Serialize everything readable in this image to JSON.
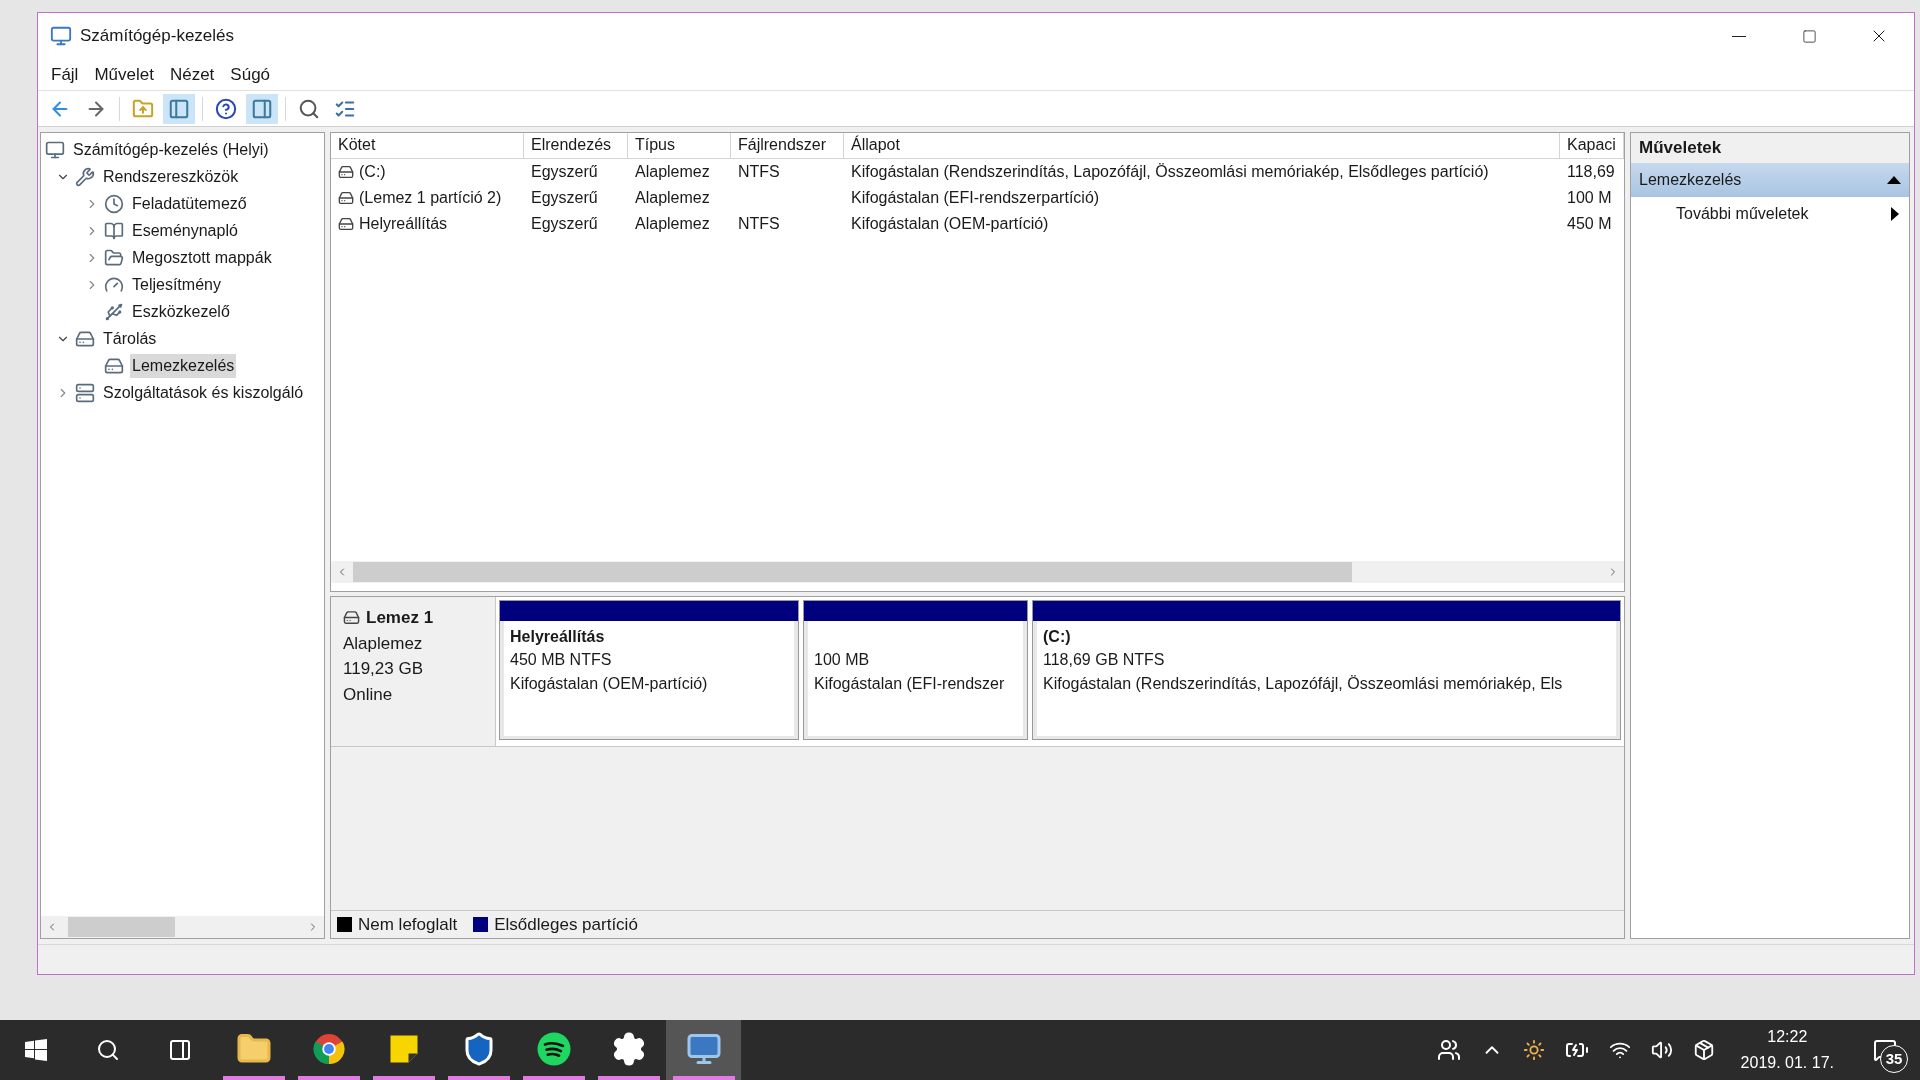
{
  "window": {
    "title": "Számítógép-kezelés"
  },
  "menu": [
    "Fájl",
    "Művelet",
    "Nézet",
    "Súgó"
  ],
  "toolbar": [
    {
      "selected": false
    },
    {
      "selected": false
    },
    {
      "selected": false
    },
    {
      "selected": true
    },
    {
      "selected": false
    },
    {
      "selected": true
    },
    {
      "selected": false
    },
    {
      "selected": false
    }
  ],
  "tree": [
    {
      "label": "Számítógép-kezelés (Helyi)",
      "selected": false,
      "children": [
        {
          "label": "Rendszereszközök",
          "expanded": true,
          "selected": false,
          "children": [
            {
              "label": "Feladatütemező",
              "expanded": false,
              "selected": false
            },
            {
              "label": "Eseménynapló",
              "expanded": false,
              "selected": false
            },
            {
              "label": "Megosztott mappák",
              "expanded": false,
              "selected": false
            },
            {
              "label": "Teljesítmény",
              "expanded": false,
              "selected": false
            },
            {
              "label": "Eszközkezelő",
              "selected": false
            }
          ]
        },
        {
          "label": "Tárolás",
          "expanded": true,
          "selected": false,
          "children": [
            {
              "label": "Lemezkezelés",
              "selected": true
            }
          ]
        },
        {
          "label": "Szolgáltatások és kiszolgáló",
          "expanded": false,
          "selected": false
        }
      ]
    }
  ],
  "table": {
    "columns": [
      "Kötet",
      "Elrendezés",
      "Típus",
      "Fájlrendszer",
      "Állapot",
      "Kapaci"
    ],
    "rows": [
      [
        "(C:)",
        "Egyszerű",
        "Alaplemez",
        "NTFS",
        "Kifogástalan (Rendszerindítás, Lapozófájl, Összeomlási memóriakép, Elsődleges partíció)",
        "118,69"
      ],
      [
        "(Lemez 1 partíció 2)",
        "Egyszerű",
        "Alaplemez",
        "",
        "Kifogástalan (EFI-rendszerpartíció)",
        "100 M"
      ],
      [
        "Helyreállítás",
        "Egyszerű",
        "Alaplemez",
        "NTFS",
        "Kifogástalan (OEM-partíció)",
        "450 M"
      ]
    ]
  },
  "disk": {
    "name": "Lemez 1",
    "type": "Alaplemez",
    "size": "119,23 GB",
    "status": "Online",
    "partitions": [
      {
        "title": "Helyreállítás",
        "size": "450 MB NTFS",
        "status": "Kifogástalan (OEM-partíció)",
        "color": "#00007f"
      },
      {
        "size": "100 MB",
        "status": "Kifogástalan (EFI-rendszer",
        "color": "#00007f"
      },
      {
        "title": "(C:)",
        "size": "118,69 GB NTFS",
        "status": "Kifogástalan (Rendszerindítás, Lapozófájl, Összeomlási memóriakép, Els",
        "color": "#00007f"
      }
    ]
  },
  "legend": [
    {
      "label": "Nem lefoglalt",
      "color": "#000000"
    },
    {
      "label": "Elsődleges partíció",
      "color": "#00007f"
    }
  ],
  "actions": {
    "title": "Műveletek",
    "section": {
      "label": "Lemezkezelés",
      "expanded": true
    },
    "items": [
      "További műveletek"
    ]
  },
  "taskbar": {
    "apps": [
      {
        "selected": false
      },
      {
        "selected": false
      },
      {
        "selected": false
      },
      {
        "selected": false
      },
      {
        "selected": false
      },
      {
        "selected": false
      },
      {
        "selected": true
      }
    ],
    "time": "12:22",
    "date": "2019. 01. 17.",
    "notifications": "35"
  }
}
